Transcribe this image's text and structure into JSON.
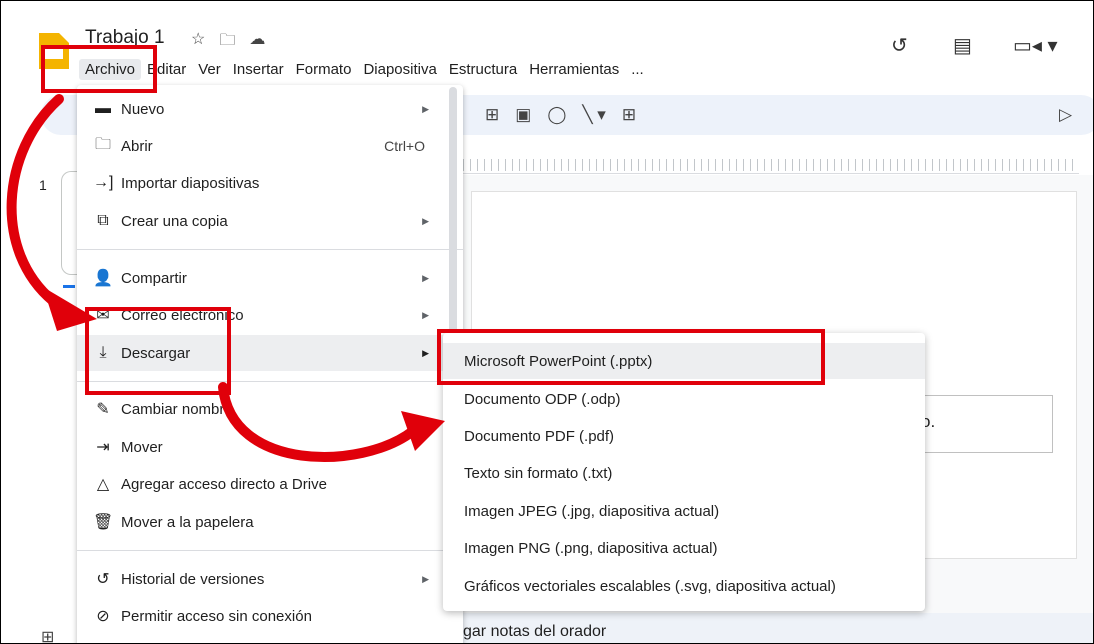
{
  "header": {
    "doc_title": "Trabajo 1",
    "title_icons": [
      "star-icon",
      "move-folder-icon",
      "cloud-saved-icon"
    ],
    "right_icons": [
      "history-icon",
      "comments-icon",
      "meet-icon"
    ]
  },
  "menubar": {
    "items": [
      "Archivo",
      "Editar",
      "Ver",
      "Insertar",
      "Formato",
      "Diapositiva",
      "Estructura",
      "Herramientas",
      "..."
    ]
  },
  "file_menu": {
    "items": [
      {
        "icon": "new-slides-icon",
        "label": "Nuevo",
        "shortcut": "",
        "submenu": true
      },
      {
        "icon": "folder-open-icon",
        "label": "Abrir",
        "shortcut": "Ctrl+O",
        "submenu": false
      },
      {
        "icon": "import-icon",
        "label": "Importar diapositivas",
        "shortcut": "",
        "submenu": false
      },
      {
        "icon": "copy-icon",
        "label": "Crear una copia",
        "shortcut": "",
        "submenu": true
      },
      {
        "icon": "share-person-icon",
        "label": "Compartir",
        "shortcut": "",
        "submenu": true
      },
      {
        "icon": "email-icon",
        "label": "Correo electrónico",
        "shortcut": "",
        "submenu": true
      },
      {
        "icon": "download-icon",
        "label": "Descargar",
        "shortcut": "",
        "submenu": true
      },
      {
        "icon": "rename-icon",
        "label": "Cambiar nombre",
        "shortcut": "",
        "submenu": false
      },
      {
        "icon": "move-icon",
        "label": "Mover",
        "shortcut": "",
        "submenu": false
      },
      {
        "icon": "drive-shortcut-icon",
        "label": "Agregar acceso directo a Drive",
        "shortcut": "",
        "submenu": false
      },
      {
        "icon": "trash-icon",
        "label": "Mover a la papelera",
        "shortcut": "",
        "submenu": false
      },
      {
        "icon": "version-history-icon",
        "label": "Historial de versiones",
        "shortcut": "",
        "submenu": true
      },
      {
        "icon": "offline-icon",
        "label": "Permitir acceso sin conexión",
        "shortcut": "",
        "submenu": false
      }
    ]
  },
  "download_submenu": {
    "items": [
      "Microsoft PowerPoint (.pptx)",
      "Documento ODP (.odp)",
      "Documento PDF (.pdf)",
      "Texto sin formato (.txt)",
      "Imagen JPEG (.jpg, diapositiva actual)",
      "Imagen PNG (.png, diapositiva actual)",
      "Gráficos vectoriales escalables (.svg, diapositiva actual)"
    ]
  },
  "filmstrip": {
    "slide_number": "1"
  },
  "slide": {
    "text_fragment": "o."
  },
  "notes": {
    "placeholder": "gar notas del orador"
  },
  "colors": {
    "annotation_red": "#e0000a",
    "highlight": "#edeef0",
    "toolbar_bg": "#edf2fa"
  }
}
